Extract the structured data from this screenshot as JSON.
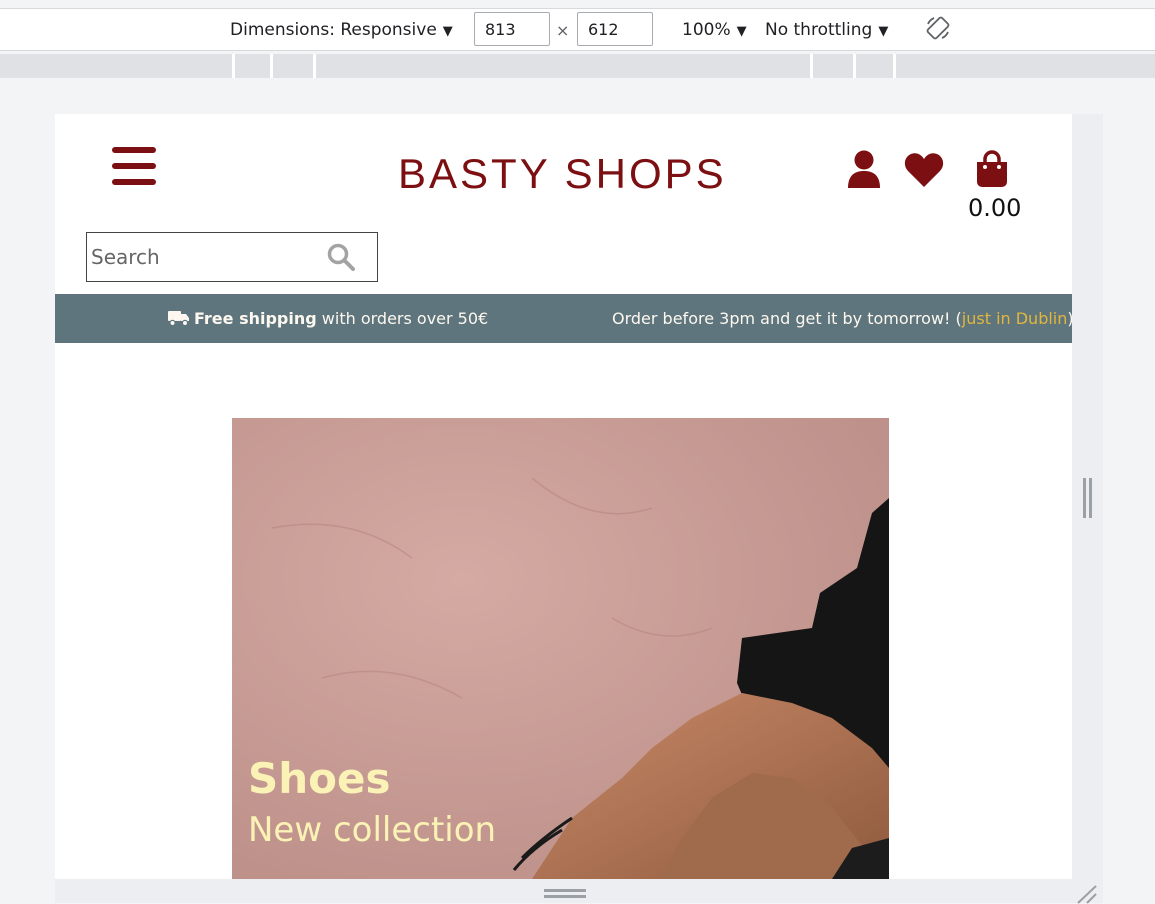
{
  "devtools": {
    "dimensions_label": "Dimensions: Responsive",
    "width_value": "813",
    "height_value": "612",
    "times_sign": "×",
    "zoom_label": "100%",
    "throttling_label": "No throttling",
    "caret": "▼"
  },
  "header": {
    "logo_text": "BASTY SHOPS",
    "cart_total": "0.00"
  },
  "search": {
    "placeholder": "Search"
  },
  "banner": {
    "shipping_bold": "Free shipping",
    "shipping_rest": " with orders over 50€",
    "delivery_text": "Order before 3pm and get it by tomorrow! (",
    "delivery_accent": "just in Dublin",
    "delivery_close": ")"
  },
  "hero": {
    "title": "Shoes",
    "subtitle": "New collection"
  },
  "colors": {
    "brand": "#7c0f11",
    "banner_bg": "#5f757d",
    "accent": "#e2b63c",
    "hero_text": "#fbf3b6"
  },
  "icons": [
    "hamburger-menu-icon",
    "user-icon",
    "heart-icon",
    "shopping-bag-icon",
    "search-icon",
    "truck-icon",
    "rotate-icon"
  ]
}
